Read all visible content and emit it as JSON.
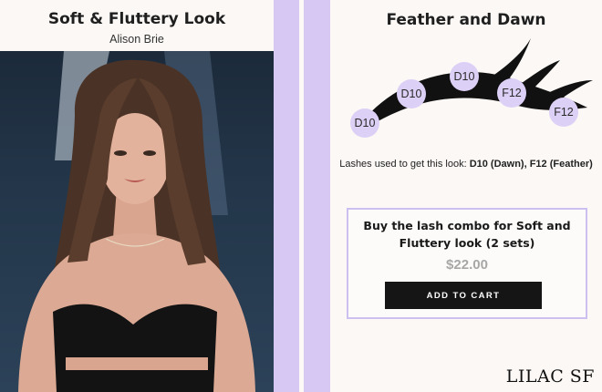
{
  "left": {
    "title": "Soft & Fluttery Look",
    "subtitle": "Alison Brie"
  },
  "right": {
    "title": "Feather and Dawn",
    "lash_badges": [
      "D10",
      "D10",
      "D10",
      "F12",
      "F12"
    ],
    "lashes_used_prefix": "Lashes used to get this look: ",
    "lashes_used_value": "D10 (Dawn), F12 (Feather)",
    "combo": {
      "title": "Buy the lash combo for Soft and Fluttery look (2 sets)",
      "price": "$22.00",
      "button_label": "ADD TO CART"
    }
  },
  "brand": "LILAC SF",
  "colors": {
    "accent_lilac": "#d6c8f2",
    "badge_fill": "#ddd0f6",
    "button": "#151515",
    "price_gray": "#a7a7a7"
  }
}
